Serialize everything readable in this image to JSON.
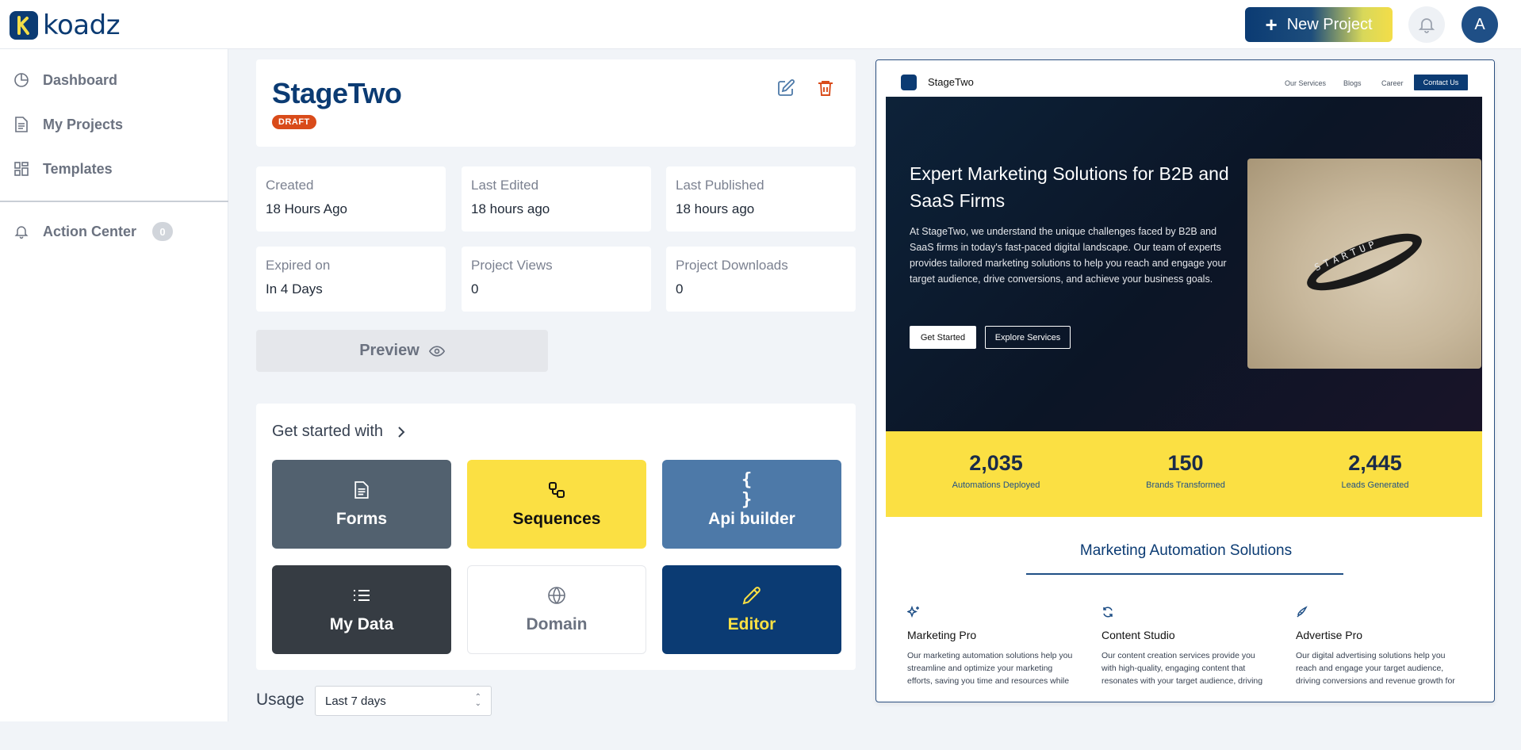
{
  "header": {
    "logo_text": "koadz",
    "new_project_label": "New Project",
    "avatar_initial": "A"
  },
  "sidebar": {
    "items": [
      {
        "label": "Dashboard",
        "icon": "pie-chart-icon"
      },
      {
        "label": "My Projects",
        "icon": "document-icon"
      },
      {
        "label": "Templates",
        "icon": "grid-icon"
      }
    ],
    "action_center": {
      "label": "Action Center",
      "count": "0",
      "icon": "bell-icon"
    }
  },
  "project": {
    "title": "StageTwo",
    "status": "DRAFT",
    "status_color": "#d94b1a"
  },
  "stats": [
    {
      "label": "Created",
      "value": "18 Hours Ago"
    },
    {
      "label": "Last Edited",
      "value": "18 hours ago"
    },
    {
      "label": "Last Published",
      "value": "18 hours ago"
    },
    {
      "label": "Expired on",
      "value": "In 4 Days"
    },
    {
      "label": "Project Views",
      "value": "0"
    },
    {
      "label": "Project Downloads",
      "value": "0"
    }
  ],
  "preview_label": "Preview",
  "get_started": {
    "title": "Get started with",
    "tiles": [
      {
        "label": "Forms",
        "icon": "document-icon",
        "bg": "#52616f",
        "fg": "#ffffff"
      },
      {
        "label": "Sequences",
        "icon": "flow-icon",
        "bg": "#fbe043",
        "fg": "#111111"
      },
      {
        "label": "Api builder",
        "icon": "braces-icon",
        "bg": "#4d79a8",
        "fg": "#ffffff"
      },
      {
        "label": "My Data",
        "icon": "list-icon",
        "bg": "#363c43",
        "fg": "#ffffff"
      },
      {
        "label": "Domain",
        "icon": "globe-icon",
        "bg": "#ffffff",
        "fg": "#6b7280"
      },
      {
        "label": "Editor",
        "icon": "pencil-icon",
        "bg": "#0b3b73",
        "fg": "#fbe043"
      }
    ]
  },
  "usage": {
    "label": "Usage",
    "selected": "Last 7 days"
  },
  "site_preview": {
    "brand": "StageTwo",
    "nav_links": [
      "Our Services",
      "Blogs",
      "Career"
    ],
    "contact": "Contact Us",
    "hero_title": "Expert Marketing Solutions for B2B and SaaS Firms",
    "hero_text": "At StageTwo, we understand the unique challenges faced by B2B and SaaS firms in today's fast-paced digital landscape. Our team of experts provides tailored marketing solutions to help you reach and engage your target audience, drive conversions, and achieve your business goals.",
    "cta_primary": "Get Started",
    "cta_secondary": "Explore Services",
    "image_text": "STARTUP",
    "stats": [
      {
        "number": "2,035",
        "label": "Automations Deployed"
      },
      {
        "number": "150",
        "label": "Brands Transformed"
      },
      {
        "number": "2,445",
        "label": "Leads Generated"
      }
    ],
    "section_title": "Marketing Automation Solutions",
    "features": [
      {
        "title": "Marketing Pro",
        "text": "Our marketing automation solutions help you streamline and optimize your marketing efforts, saving you time and resources while driving revenue growth."
      },
      {
        "title": "Content Studio",
        "text": "Our content creation services provide you with high-quality, engaging content that resonates with your target audience, driving conversions and revenue growth."
      },
      {
        "title": "Advertise Pro",
        "text": "Our digital advertising solutions help you reach and engage your target audience, driving conversions and revenue growth for your business."
      }
    ]
  }
}
